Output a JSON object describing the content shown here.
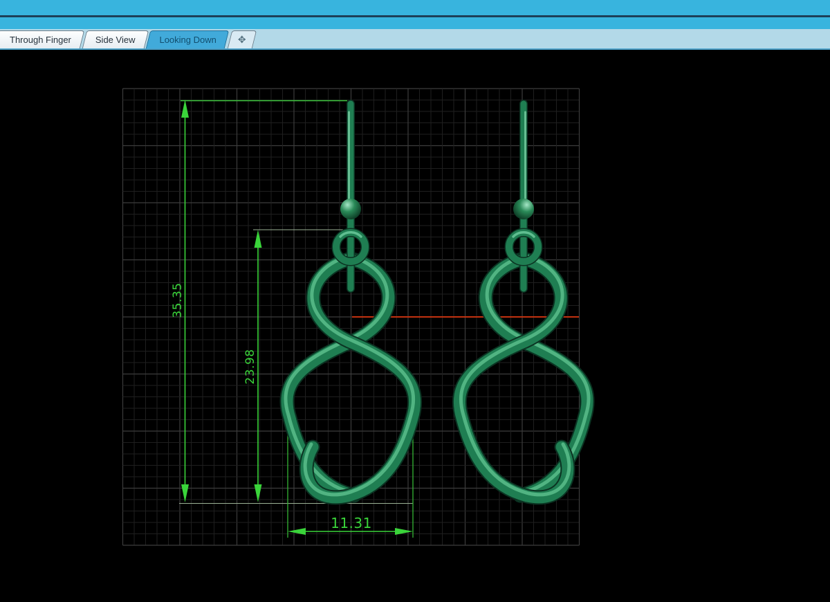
{
  "tabs": {
    "items": [
      {
        "label": "Through Finger",
        "active": false
      },
      {
        "label": "Side View",
        "active": false
      },
      {
        "label": "Looking Down",
        "active": true
      }
    ],
    "move_tab_icon": "✥"
  },
  "viewport": {
    "view_name": "Looking Down",
    "dimensions": {
      "overall_height": "35.35",
      "inner_height": "23.98",
      "width": "11.31"
    }
  },
  "colors": {
    "titlebar_blue": "#38b4de",
    "titlebar_divider": "#1d3f57",
    "tab_strip": "#b3d9e8",
    "active_tab_blue": "#41aada",
    "dimension_green": "#3ad43a",
    "axis_red": "#c23210",
    "earring_green": "#1f7e52",
    "grid_minor": "#1f1f1f",
    "grid_major": "#3c3c3c",
    "background": "#000000"
  }
}
